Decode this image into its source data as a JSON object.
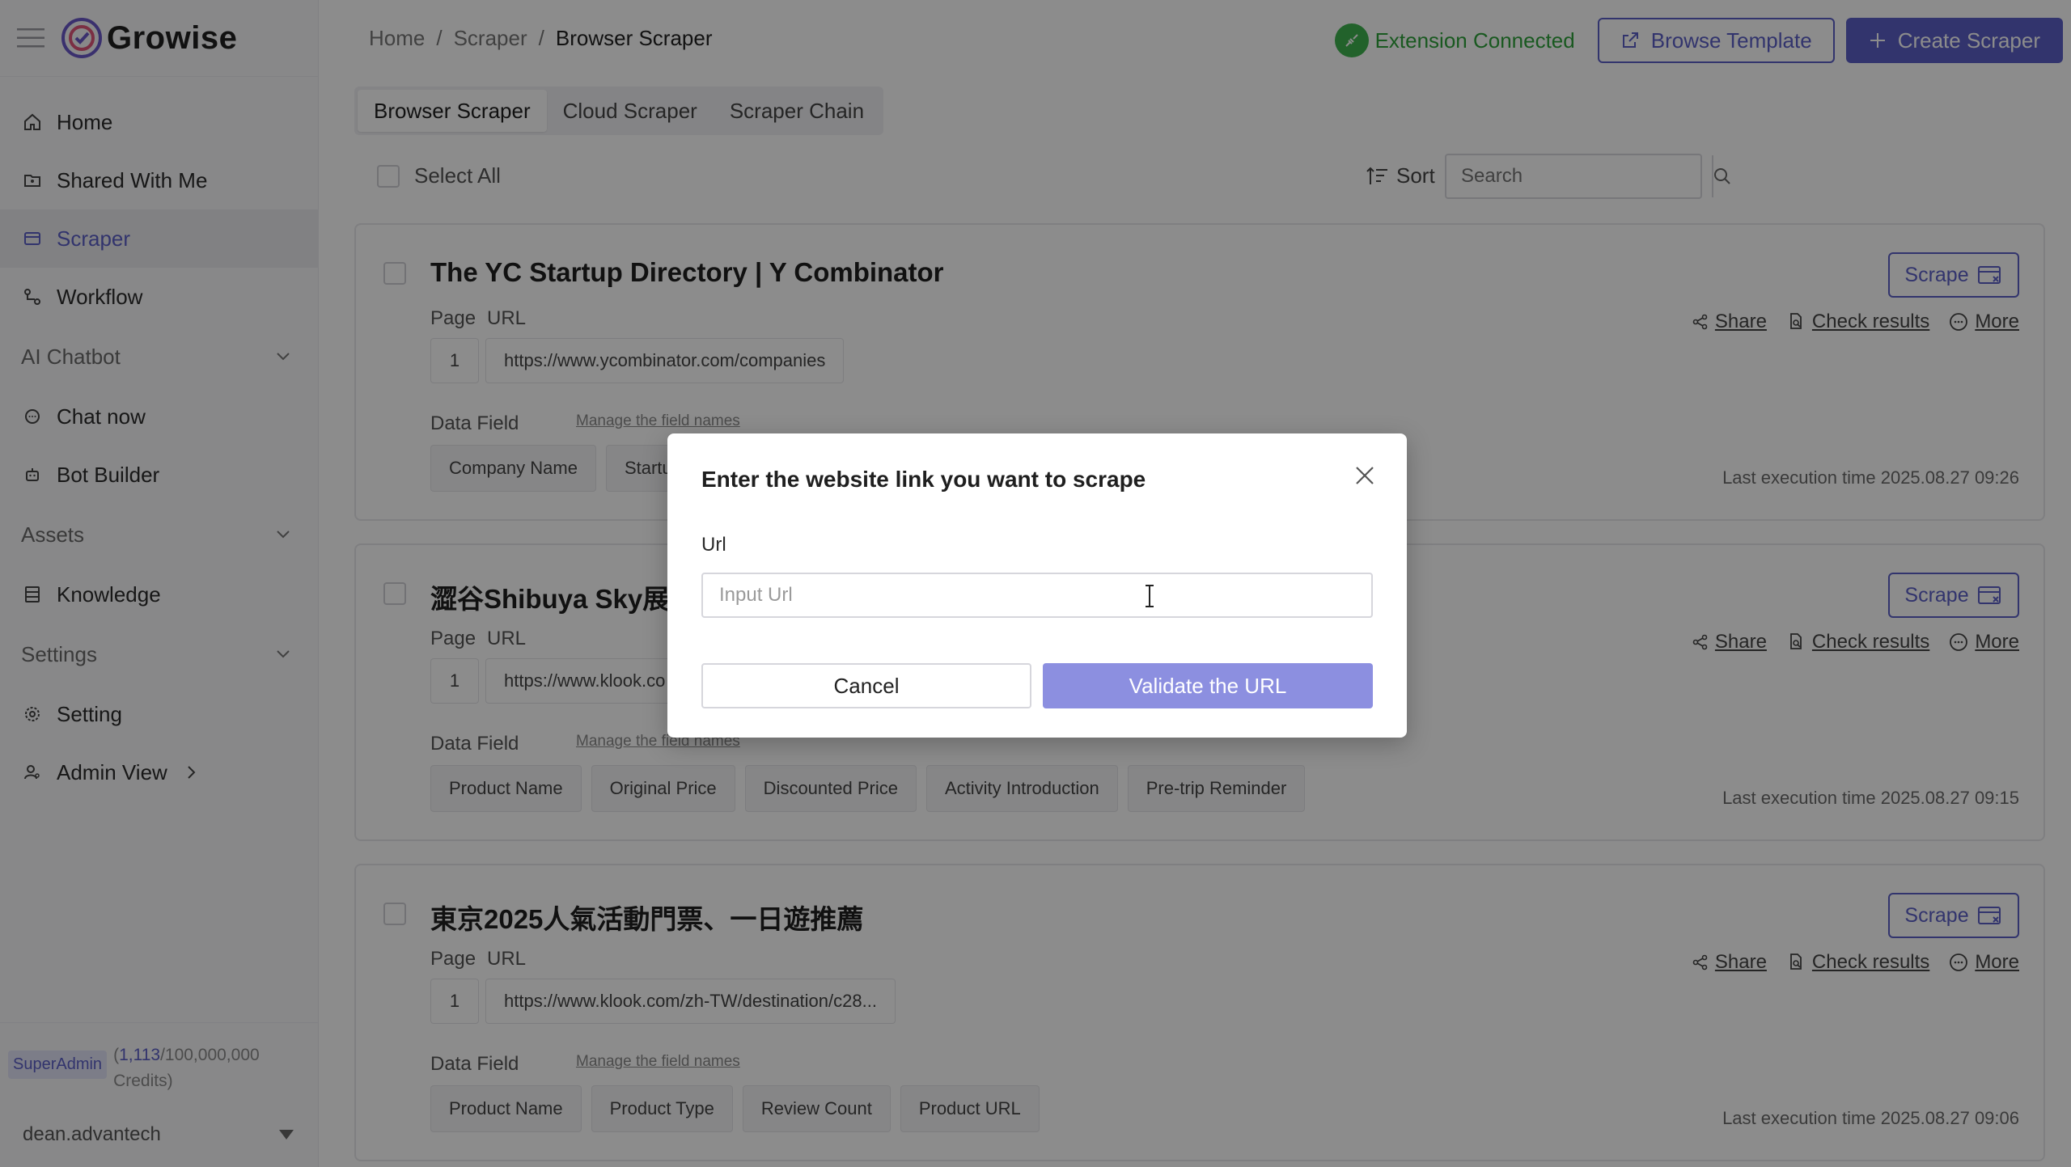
{
  "app": {
    "name": "Growise"
  },
  "sidebar": {
    "items": [
      {
        "label": "Home",
        "icon": "home-icon"
      },
      {
        "label": "Shared With Me",
        "icon": "folder-shared-icon"
      },
      {
        "label": "Scraper",
        "icon": "scraper-icon",
        "active": true
      },
      {
        "label": "Workflow",
        "icon": "workflow-icon"
      }
    ],
    "sections": {
      "ai_chatbot": "AI Chatbot",
      "chat_now": "Chat now",
      "bot_builder": "Bot Builder",
      "assets": "Assets",
      "knowledge": "Knowledge",
      "settings": "Settings",
      "setting": "Setting",
      "admin_view": "Admin View"
    },
    "credits": {
      "badge": "SuperAdmin",
      "open": "(",
      "used": "1,113",
      "total": "/100,000,000",
      "unit": "Credits)"
    },
    "user": "dean.advantech"
  },
  "header": {
    "breadcrumb": [
      "Home",
      "Scraper",
      "Browser Scraper"
    ],
    "extension_status": "Extension Connected",
    "browse_template": "Browse Template",
    "create_scraper": "Create Scraper"
  },
  "tabs": [
    "Browser Scraper",
    "Cloud Scraper",
    "Scraper Chain"
  ],
  "toolbar": {
    "select_all": "Select All",
    "sort": "Sort",
    "search_placeholder": "Search"
  },
  "card_labels": {
    "page": "Page",
    "url": "URL",
    "data_field": "Data Field",
    "manage": "Manage the field names",
    "scrape": "Scrape",
    "share": "Share",
    "check_results": "Check results",
    "more": "More"
  },
  "cards": [
    {
      "title": "The YC Startup Directory | Y Combinator",
      "page": "1",
      "url": "https://www.ycombinator.com/companies",
      "fields": [
        "Company Name",
        "Startu"
      ],
      "last_exec": "Last execution time 2025.08.27 09:26"
    },
    {
      "title": "澀谷Shibuya Sky展望",
      "page": "1",
      "url": "https://www.klook.co",
      "fields": [
        "Product Name",
        "Original Price",
        "Discounted Price",
        "Activity Introduction",
        "Pre-trip Reminder"
      ],
      "last_exec": "Last execution time 2025.08.27 09:15"
    },
    {
      "title": "東京2025人氣活動門票、一日遊推薦",
      "page": "1",
      "url": "https://www.klook.com/zh-TW/destination/c28...",
      "fields": [
        "Product Name",
        "Product Type",
        "Review Count",
        "Product URL"
      ],
      "last_exec": "Last execution time 2025.08.27 09:06"
    }
  ],
  "modal": {
    "title": "Enter the website link you want to scrape",
    "label": "Url",
    "placeholder": "Input Url",
    "value": "",
    "cancel": "Cancel",
    "validate": "Validate the URL"
  },
  "colors": {
    "accent": "#5b5fc7",
    "success": "#3fb34f",
    "validate_disabled": "#8c8fe0"
  }
}
